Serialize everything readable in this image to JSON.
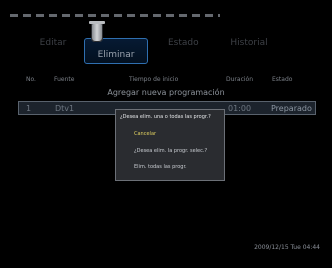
{
  "tabs": [
    {
      "label": "Editar"
    },
    {
      "label": "Eliminar",
      "active": true
    },
    {
      "label": "Estado"
    },
    {
      "label": "Historial"
    }
  ],
  "columns": {
    "no": "No.",
    "source": "Fuente",
    "start_time": "Tiempo de inicio",
    "duration": "Duración",
    "status": "Estado"
  },
  "subtitle": "Agregar nueva programación",
  "row": {
    "no": "1",
    "source": "Dtv1",
    "duration": "01:00",
    "status": "Preparado"
  },
  "dialog": {
    "title": "¿Desea elim. una o todas las progr.?",
    "cancel": "Cancelar",
    "delete_selected": "¿Desea elim. la progr. selec.?",
    "delete_all": "Elim. todas las progr."
  },
  "datetime": "2009/12/15 Tue 04:44"
}
